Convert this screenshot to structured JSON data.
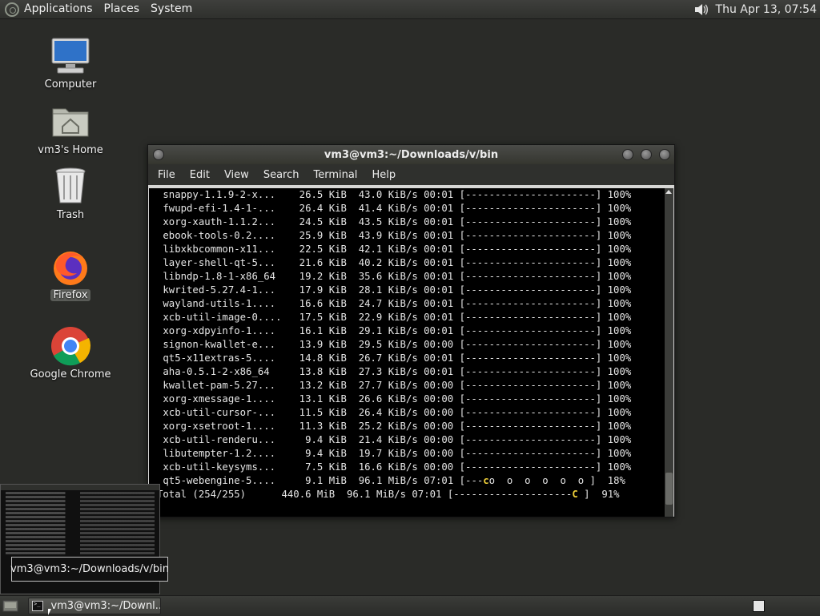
{
  "top_panel": {
    "menus": [
      "Applications",
      "Places",
      "System"
    ],
    "clock": "Thu Apr 13, 07:54"
  },
  "desktop_icons": [
    {
      "label": "Computer",
      "icon": "computer-icon"
    },
    {
      "label": "vm3's Home",
      "icon": "home-folder-icon"
    },
    {
      "label": "Trash",
      "icon": "trash-icon"
    },
    {
      "label": "Firefox",
      "icon": "firefox-icon"
    },
    {
      "label": "Google Chrome",
      "icon": "chrome-icon"
    }
  ],
  "terminal": {
    "title": "vm3@vm3:~/Downloads/v/bin",
    "menu": [
      "File",
      "Edit",
      "View",
      "Search",
      "Terminal",
      "Help"
    ],
    "lines": [
      " snappy-1.1.9-2-x...    26.5 KiB  43.0 KiB/s 00:01 [----------------------] 100%",
      " fwupd-efi-1.4-1-...    26.4 KiB  41.4 KiB/s 00:01 [----------------------] 100%",
      " xorg-xauth-1.1.2...    24.5 KiB  43.5 KiB/s 00:01 [----------------------] 100%",
      " ebook-tools-0.2....    25.9 KiB  43.9 KiB/s 00:01 [----------------------] 100%",
      " libxkbcommon-x11...    22.5 KiB  42.1 KiB/s 00:01 [----------------------] 100%",
      " layer-shell-qt-5...    21.6 KiB  40.2 KiB/s 00:01 [----------------------] 100%",
      " libndp-1.8-1-x86_64    19.2 KiB  35.6 KiB/s 00:01 [----------------------] 100%",
      " kwrited-5.27.4-1...    17.9 KiB  28.1 KiB/s 00:01 [----------------------] 100%",
      " wayland-utils-1....    16.6 KiB  24.7 KiB/s 00:01 [----------------------] 100%",
      " xcb-util-image-0....   17.5 KiB  22.9 KiB/s 00:01 [----------------------] 100%",
      " xorg-xdpyinfo-1....    16.1 KiB  29.1 KiB/s 00:01 [----------------------] 100%",
      " signon-kwallet-e...    13.9 KiB  29.5 KiB/s 00:00 [----------------------] 100%",
      " qt5-x11extras-5....    14.8 KiB  26.7 KiB/s 00:01 [----------------------] 100%",
      " aha-0.5.1-2-x86_64     13.8 KiB  27.3 KiB/s 00:01 [----------------------] 100%",
      " kwallet-pam-5.27...    13.2 KiB  27.7 KiB/s 00:00 [----------------------] 100%",
      " xorg-xmessage-1....    13.1 KiB  26.6 KiB/s 00:00 [----------------------] 100%",
      " xcb-util-cursor-...    11.5 KiB  26.4 KiB/s 00:00 [----------------------] 100%",
      " xorg-xsetroot-1....    11.3 KiB  25.2 KiB/s 00:00 [----------------------] 100%",
      " xcb-util-renderu...     9.4 KiB  21.4 KiB/s 00:00 [----------------------] 100%",
      " libutempter-1.2....     9.4 KiB  19.7 KiB/s 00:00 [----------------------] 100%",
      " xcb-util-keysyms...     7.5 KiB  16.6 KiB/s 00:00 [----------------------] 100%"
    ],
    "progress_line": {
      "name": " qt5-webengine-5....",
      "size": "9.1 MiB",
      "rate": "96.1 MiB/s",
      "time": "07:01",
      "bar_prefix": "[---",
      "pac": "c",
      "bar_rest": "o  o  o  o  o  o ]",
      "percent": "18%"
    },
    "total_line": {
      "name": "Total (254/255)",
      "size": "440.6 MiB",
      "rate": "96.1 MiB/s",
      "time": "07:01",
      "bar_prefix": "[--------------------",
      "pac": "C",
      "bar_rest": " ]",
      "percent": "91%"
    }
  },
  "tooltip": "vm3@vm3:~/Downloads/v/bin",
  "taskbar": {
    "task_label": "vm3@vm3:~/Downl..."
  }
}
